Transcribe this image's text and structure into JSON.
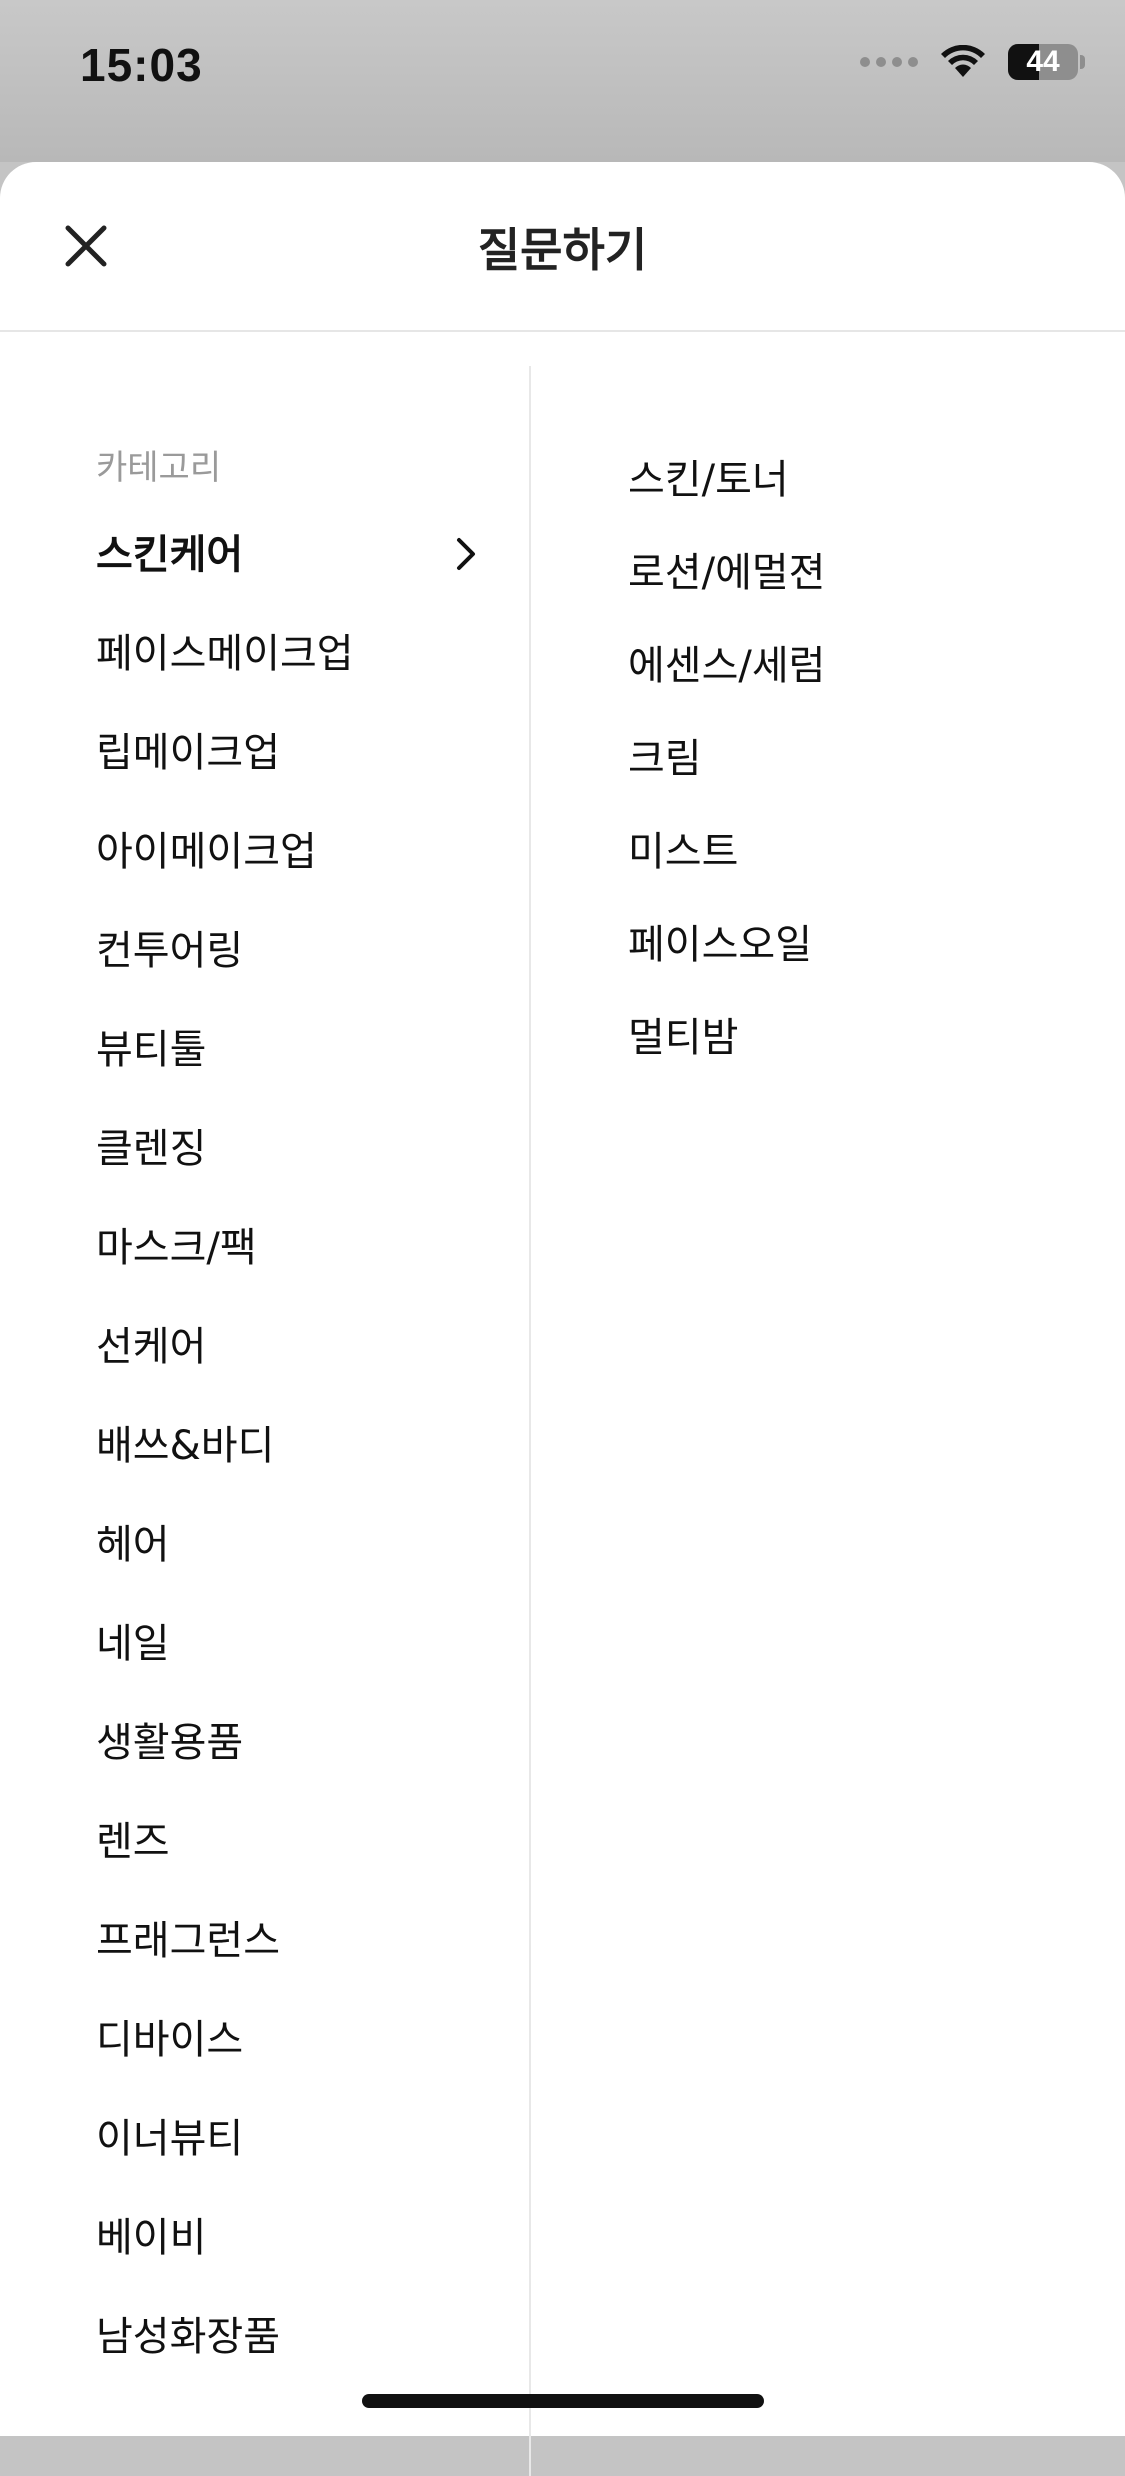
{
  "status_bar": {
    "time": "15:03",
    "battery": "44",
    "battery_level": 0.44
  },
  "header": {
    "title": "질문하기",
    "close_icon": "close-icon"
  },
  "categories": {
    "label": "카테고리",
    "items": [
      "스킨케어",
      "페이스메이크업",
      "립메이크업",
      "아이메이크업",
      "컨투어링",
      "뷰티툴",
      "클렌징",
      "마스크/팩",
      "선케어",
      "배쓰&바디",
      "헤어",
      "네일",
      "생활용품",
      "렌즈",
      "프래그런스",
      "디바이스",
      "이너뷰티",
      "베이비",
      "남성화장품"
    ],
    "selected_index": 0
  },
  "subcategories": {
    "items": [
      "스킨/토너",
      "로션/에멀젼",
      "에센스/세럼",
      "크림",
      "미스트",
      "페이스오일",
      "멀티밤"
    ]
  }
}
